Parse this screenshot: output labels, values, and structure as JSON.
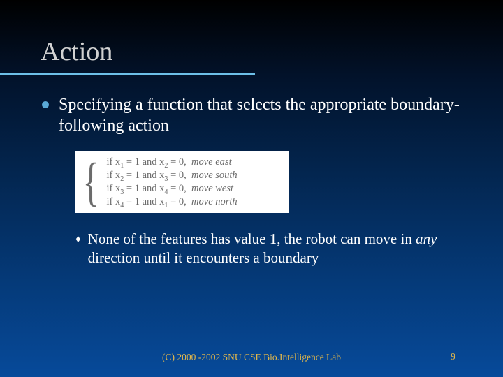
{
  "title": "Action",
  "bullet1": "Specifying a function that selects the appropriate boundary-following action",
  "rules": {
    "brace": "{",
    "rows": [
      {
        "if": "if",
        "va": "x",
        "sa": "1",
        "eq1_lhs": "= 1",
        "and": "and",
        "vb": "x",
        "sb": "2",
        "eq2_lhs": "= 0,",
        "dir": "move east"
      },
      {
        "if": "if",
        "va": "x",
        "sa": "2",
        "eq1_lhs": "= 1",
        "and": "and",
        "vb": "x",
        "sb": "3",
        "eq2_lhs": "= 0,",
        "dir": "move south"
      },
      {
        "if": "if",
        "va": "x",
        "sa": "3",
        "eq1_lhs": "= 1",
        "and": "and",
        "vb": "x",
        "sb": "4",
        "eq2_lhs": "= 0,",
        "dir": "move west"
      },
      {
        "if": "if",
        "va": "x",
        "sa": "4",
        "eq1_lhs": "= 1",
        "and": "and",
        "vb": "x",
        "sb": "1",
        "eq2_lhs": "= 0,",
        "dir": "move north"
      }
    ]
  },
  "bullet2_pre": "None of the features has value 1, the robot can move in ",
  "bullet2_any": "any",
  "bullet2_post": " direction until it encounters a boundary",
  "footer": "(C) 2000 -2002 SNU CSE Bio.Intelligence Lab",
  "page": "9"
}
